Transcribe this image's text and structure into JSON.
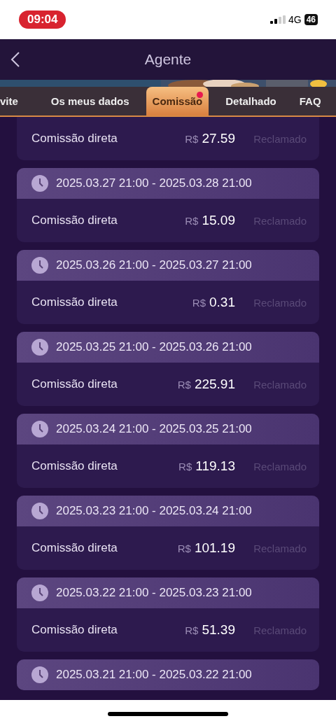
{
  "status_bar": {
    "time": "09:04",
    "network": "4G",
    "battery": "46"
  },
  "header": {
    "title": "Agente"
  },
  "tabs": [
    {
      "label": "vite",
      "selected": false,
      "dot": false
    },
    {
      "label": "Os meus dados",
      "selected": false,
      "dot": false
    },
    {
      "label": "Comissão",
      "selected": true,
      "dot": true
    },
    {
      "label": "Detalhado",
      "selected": false,
      "dot": false
    },
    {
      "label": "FAQ",
      "selected": false,
      "dot": false
    }
  ],
  "records": [
    {
      "label": "Comissão direta",
      "currency": "R$",
      "amount": "27.59",
      "status": "Reclamado"
    },
    {
      "period": "2025.03.27 21:00 - 2025.03.28 21:00",
      "label": "Comissão direta",
      "currency": "R$",
      "amount": "15.09",
      "status": "Reclamado"
    },
    {
      "period": "2025.03.26 21:00 - 2025.03.27 21:00",
      "label": "Comissão direta",
      "currency": "R$",
      "amount": "0.31",
      "status": "Reclamado"
    },
    {
      "period": "2025.03.25 21:00 - 2025.03.26 21:00",
      "label": "Comissão direta",
      "currency": "R$",
      "amount": "225.91",
      "status": "Reclamado"
    },
    {
      "period": "2025.03.24 21:00 - 2025.03.25 21:00",
      "label": "Comissão direta",
      "currency": "R$",
      "amount": "119.13",
      "status": "Reclamado"
    },
    {
      "period": "2025.03.23 21:00 - 2025.03.24 21:00",
      "label": "Comissão direta",
      "currency": "R$",
      "amount": "101.19",
      "status": "Reclamado"
    },
    {
      "period": "2025.03.22 21:00 - 2025.03.23 21:00",
      "label": "Comissão direta",
      "currency": "R$",
      "amount": "51.39",
      "status": "Reclamado"
    },
    {
      "period": "2025.03.21 21:00 - 2025.03.22 21:00"
    }
  ]
}
